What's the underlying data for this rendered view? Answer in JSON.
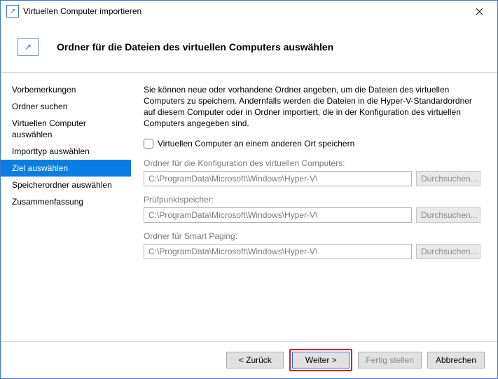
{
  "titlebar": {
    "icon_glyph": "↗",
    "title": "Virtuellen Computer importieren"
  },
  "header": {
    "icon_glyph": "↗",
    "title": "Ordner für die Dateien des virtuellen Computers auswählen"
  },
  "sidebar": {
    "items": [
      {
        "label": "Vorbemerkungen"
      },
      {
        "label": "Ordner suchen"
      },
      {
        "label": "Virtuellen Computer auswählen"
      },
      {
        "label": "Importtyp auswählen"
      },
      {
        "label": "Ziel auswählen"
      },
      {
        "label": "Speicherordner auswählen"
      },
      {
        "label": "Zusammenfassung"
      }
    ]
  },
  "content": {
    "intro": "Sie können neue oder vorhandene Ordner angeben, um die Dateien des virtuellen Computers zu speichern. Andernfalls werden die Dateien in die Hyper-V-Standardordner auf diesem Computer oder in Ordner importiert, die in der Konfiguration des virtuellen Computers angegeben sind.",
    "checkbox_label": "Virtuellen Computer an einem anderen Ort speichern",
    "fields": [
      {
        "label": "Ordner für die Konfiguration des virtuellen Computers:",
        "value": "C:\\ProgramData\\Microsoft\\Windows\\Hyper-V\\",
        "browse": "Durchsuchen..."
      },
      {
        "label": "Prüfpunktspeicher:",
        "value": "C:\\ProgramData\\Microsoft\\Windows\\Hyper-V\\",
        "browse": "Durchsuchen..."
      },
      {
        "label": "Ordner für Smart Paging:",
        "value": "C:\\ProgramData\\Microsoft\\Windows\\Hyper-V\\",
        "browse": "Durchsuchen..."
      }
    ]
  },
  "footer": {
    "back": "< Zurück",
    "next": "Weiter >",
    "finish": "Fertig stellen",
    "cancel": "Abbrechen"
  }
}
